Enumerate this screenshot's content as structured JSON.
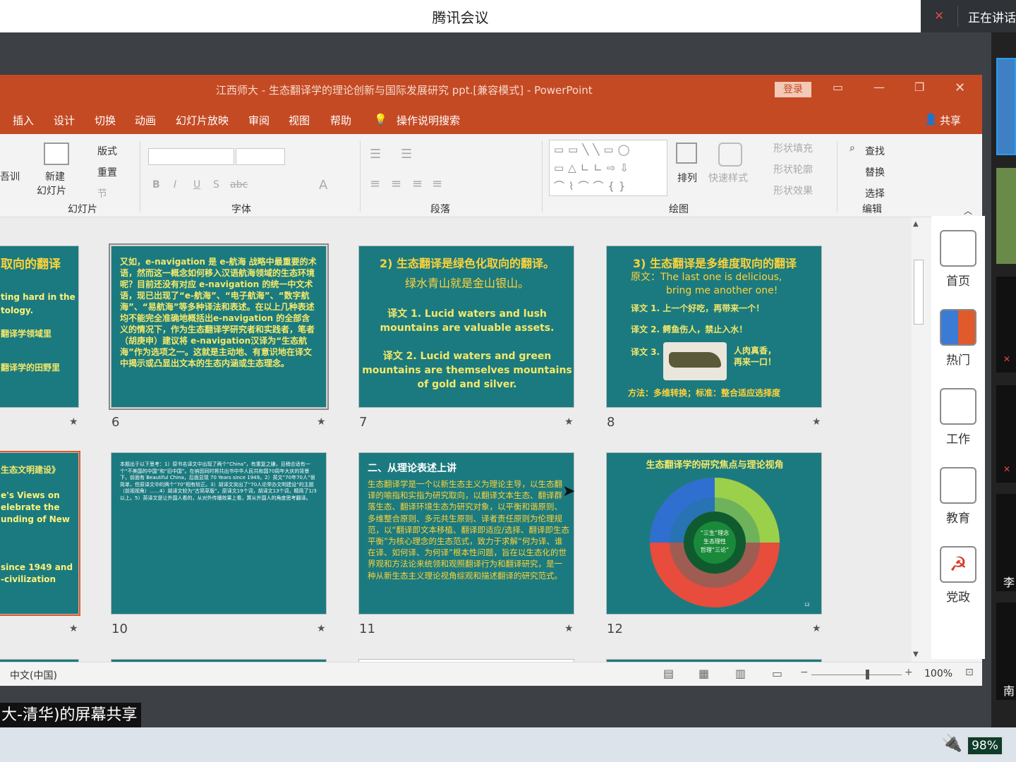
{
  "meeting": {
    "title": "腾讯会议",
    "speaking_label": "正在讲话",
    "share_banner": "大-清华)的屏幕共享"
  },
  "ppt": {
    "window_title": "江西师大 - 生态翻译学的理论创新与国际发展研究 ppt.[兼容模式]  -  PowerPoint",
    "login": "登录",
    "menu": [
      "插入",
      "设计",
      "切换",
      "动画",
      "幻灯片放映",
      "审阅",
      "视图",
      "帮助"
    ],
    "tell_me": "操作说明搜索",
    "share": "共享",
    "ribbon": {
      "partial_left": "吾训",
      "new_slide": "新建",
      "new_slide2": "幻灯片",
      "layout": "版式",
      "reset": "重置",
      "section": "节",
      "group_slides": "幻灯片",
      "group_font": "字体",
      "group_para": "段落",
      "group_draw": "绘图",
      "group_edit": "编辑",
      "arrange": "排列",
      "quick_styles": "快速样式",
      "shape_fill": "形状填充",
      "shape_outline": "形状轮廓",
      "shape_effect": "形状效果",
      "find": "查找",
      "replace": "替换",
      "select": "选择"
    },
    "slides": {
      "s5_title": "取向的翻译",
      "s5_l1": "ting hard in the",
      "s5_l2": "tology.",
      "s5_l3": "翻译学领域里",
      "s5_l4": "翻译学的田野里",
      "s6_text": "又如，e-navigation 是 e-航海 战略中最重要的术语，然而这一概念如何移入汉语航海领域的生态环境呢？目前还没有对应 e-navigation 的统一中文术语，现已出现了“e-航海”、“电子航海”、“数字航海”、“易航海”等多种译法和表述。在以上几种表述均不能完全准确地概括出e-navigation 的全部含义的情况下，作为生态翻译学研究者和实践者，笔者（胡庚申）建议将 e-navigation汉译为“生态航海”作为选项之一。这就是主动地、有意识地在译文中揭示或凸显出文本的生态内涵或生态理念。",
      "s7_title": "2) 生态翻译是绿色化取向的翻译。",
      "s7_sub": "绿水青山就是金山银山。",
      "s7_t1a": "译文 1. Lucid waters and lush",
      "s7_t1b": "mountains are valuable assets.",
      "s7_t2a": "译文 2. Lucid waters and green",
      "s7_t2b": "mountains are themselves mountains",
      "s7_t2c": "of gold and silver.",
      "s8_title": "3) 生态翻译是多维度取向的翻译",
      "s8_src": "原文：The last one is delicious,",
      "s8_src2": "bring me another one!",
      "s8_t1": "译文 1. 上一个好吃，再带来一个！",
      "s8_t2": "译文 2. 鳄鱼伤人，禁止入水！",
      "s8_t3": "译文 3.",
      "s8_t3b": "人肉真香，再来一口！",
      "s8_foot": "方法：多维转换；标准：整合适应选择度",
      "s9_title": "生态文明建设》",
      "s9_l1": "e's Views on",
      "s9_l2": "elebrate the",
      "s9_l3": "unding of New",
      "s9_l4": "since 1949 and",
      "s9_l5": "-civilization",
      "s10_text": "本题出于以下思考：1）原书名译文中出现了两个“China”，有重复之嫌，且稍合适有一个“不美国的中国”和“旧中国”。在纳因同时将共出书中华人民共和国70周年大庆的背景下，前面有 Beautiful China，后面显现 70 Years since 1949。2）英文“70年70人”很简单，但原译文中的两个“70”相有较正。3）胡译文突出了“70人论举办文明建设”的主题（前视视角）……4）胡译文较为“古简草版”，原译文19个词，胡译文13个词，精简了1/3以上。5）英译文是让外国人看的，从对外传播效果上看，算从外国人的角度思考翻译。",
      "s11_title": "二、从理论表述上讲",
      "s11_text": "生态翻译学是一个以新生态主义为理论主导，以生态翻译的喻指和实指为研究取向，以翻译文本生态、翻译群落生态、翻译环境生态为研究对象，以平衡和谐原则、多维整合原则、多元共生原则、译者责任原则为伦理规范，以“翻译即文本移植、翻译即适应/选择、翻译即生态平衡”为核心理念的生态范式，致力于求解“何为译、谁在译、如何译、为何译”根本性问题，旨在以生态化的世界观和方法论来统领和观照翻译行为和翻译研究，是一种从新生态主义理论视角综观和描述翻译的研究范式。",
      "s12_title": "生态翻译学的研究焦点与理论视角",
      "s12_center": "“三生”理念",
      "s12_center2": "生态理性",
      "s12_center3": "哲理“三论”",
      "s12_num": "12",
      "numbers": [
        "6",
        "7",
        "8",
        "10",
        "11",
        "12"
      ]
    },
    "status": {
      "lang": "中文(中国)",
      "zoom": "100%",
      "zoom_fraction": 0.6
    },
    "dock": [
      "首页",
      "热门",
      "工作",
      "教育",
      "党政"
    ]
  },
  "participants": {
    "li": "李",
    "nan": "南"
  },
  "taskbar": {
    "battery": "98%"
  }
}
